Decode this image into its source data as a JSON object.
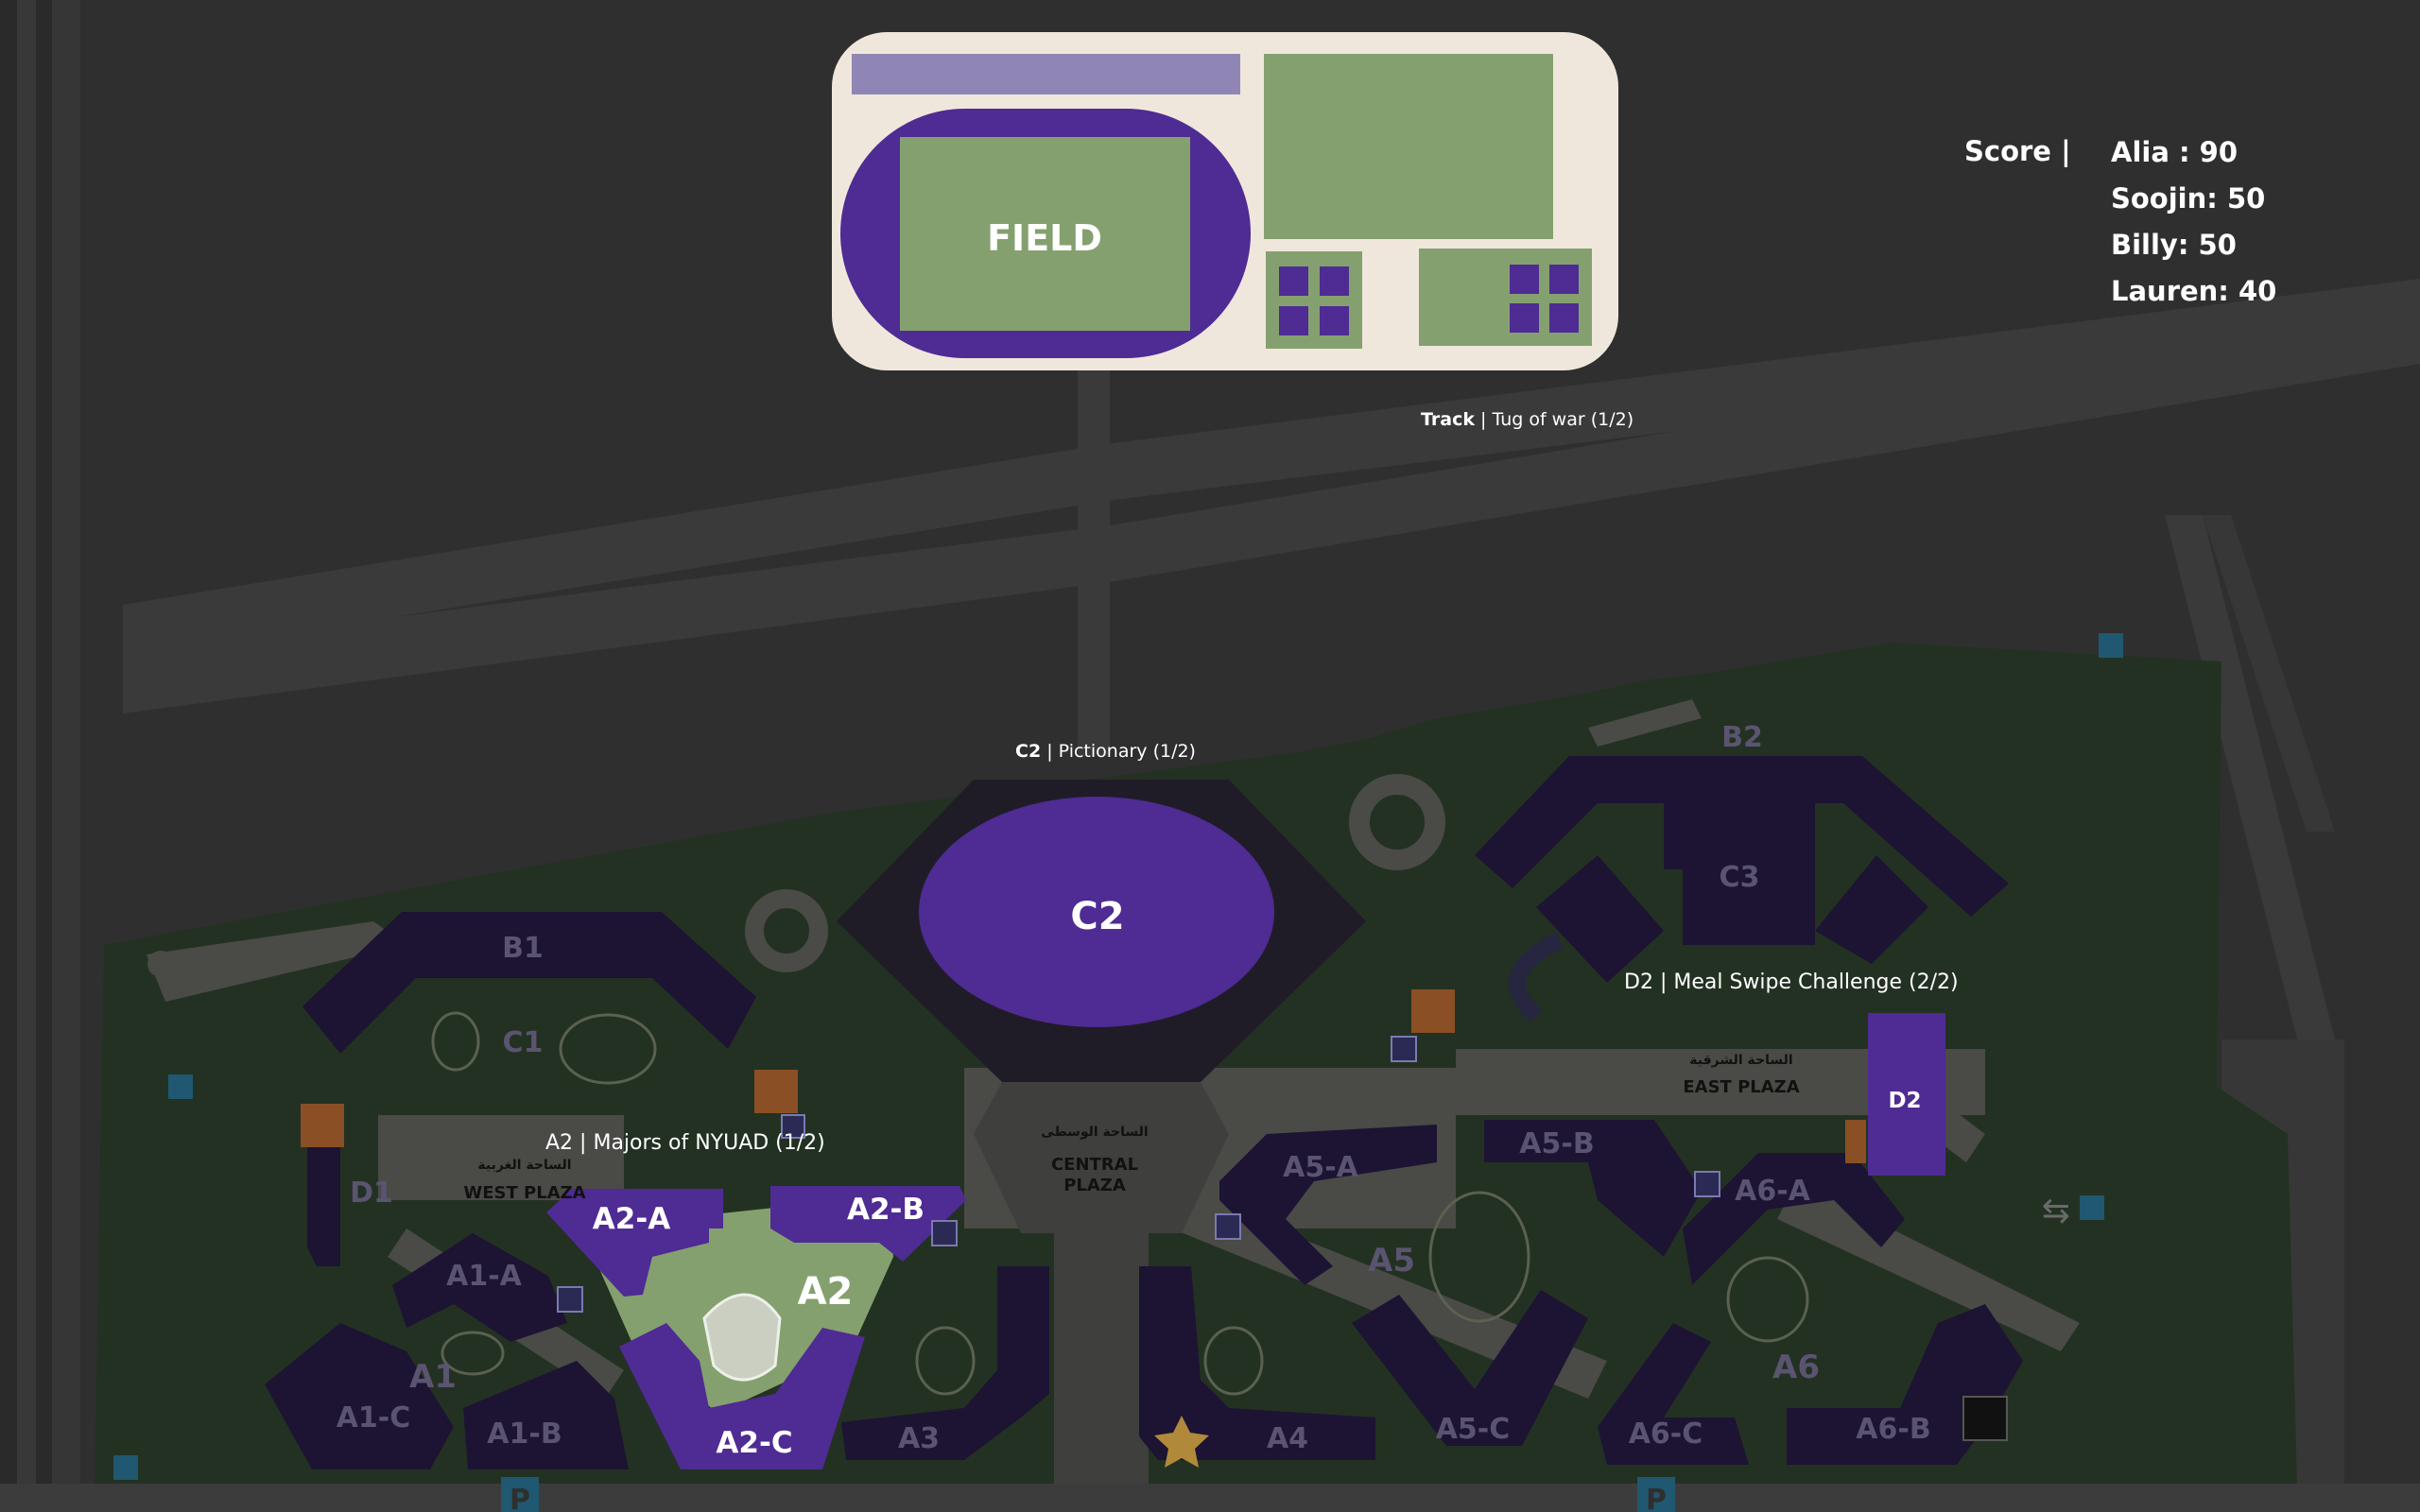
{
  "map": {
    "colors": {
      "background": "#2f2f2f",
      "road": "#3a3a3a",
      "campus_green": "#233122",
      "building_dark": "#1d1333",
      "highlight_purple": "#4f2b94",
      "field_green": "#85a06f",
      "panel_beige": "#f0e7dc",
      "track_lavender": "#8f86b5"
    },
    "field_label": "FIELD",
    "buildings": {
      "a2": "A2",
      "a2a": "A2-A",
      "a2b": "A2-B",
      "a2c": "A2-C",
      "c2": "C2",
      "d2": "D2",
      "b1": "B1",
      "b2": "B2",
      "c1": "C1",
      "c3": "C3",
      "d1": "D1",
      "a1": "A1",
      "a1a": "A1-A",
      "a1b": "A1-B",
      "a1c": "A1-C",
      "a3": "A3",
      "a4": "A4",
      "a5": "A5",
      "a5a": "A5-A",
      "a5b": "A5-B",
      "a5c": "A5-C",
      "a6": "A6",
      "a6a": "A6-A",
      "a6b": "A6-B",
      "a6c": "A6-C"
    },
    "plazas": {
      "west": "WEST PLAZA",
      "west_ar": "الساحة الغربية",
      "central_1": "CENTRAL",
      "central_2": "PLAZA",
      "central_ar": "الساحة الوسطى",
      "east": "EAST PLAZA",
      "east_ar": "الساحة الشرقية"
    },
    "parking_label": "P",
    "icons": [
      "elevator-icon",
      "stairs-icon",
      "bus-icon",
      "parking-icon",
      "star-icon",
      "tree-icon",
      "exit-icon"
    ]
  },
  "score": {
    "title": "Score |",
    "players": [
      {
        "label": "Alia : 90"
      },
      {
        "label": "Soojin: 50"
      },
      {
        "label": "Billy: 50"
      },
      {
        "label": "Lauren: 40"
      }
    ]
  },
  "events": {
    "track": {
      "location": "Track",
      "sep": "|",
      "name": "Tug of war (1/2)"
    },
    "c2": {
      "location": "C2",
      "sep": "|",
      "name": "Pictionary (1/2)"
    },
    "d2": {
      "location": "D2",
      "sep": "|",
      "name": "Meal Swipe Challenge (2/2)"
    },
    "a2": {
      "location": "A2",
      "sep": "|",
      "name": "Majors of NYUAD (1/2)"
    }
  }
}
